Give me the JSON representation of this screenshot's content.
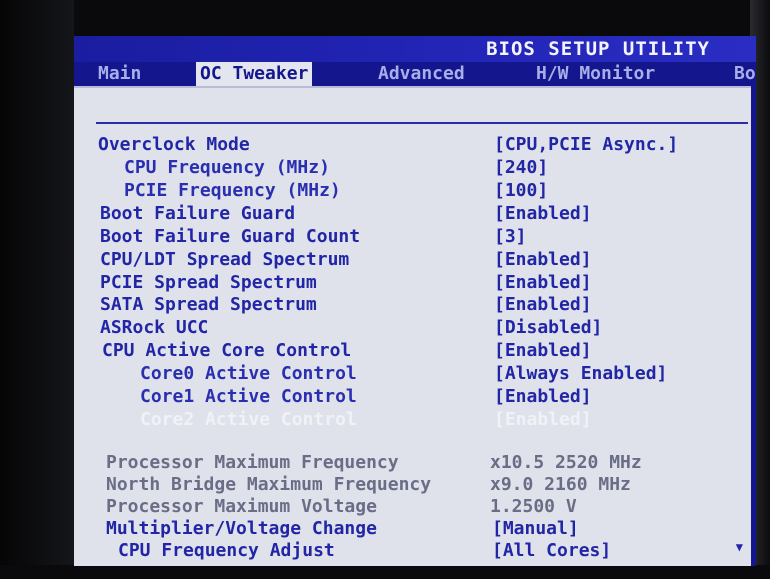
{
  "header": {
    "title": "BIOS SETUP UTILITY"
  },
  "tabs": [
    {
      "label": "Main"
    },
    {
      "label": "OC Tweaker"
    },
    {
      "label": "Advanced"
    },
    {
      "label": "H/W Monitor"
    },
    {
      "label": "Bo"
    }
  ],
  "settings": [
    {
      "label": "Overclock Mode",
      "value": "[CPU,PCIE Async.]"
    },
    {
      "label": "CPU Frequency (MHz)",
      "value": "[240]"
    },
    {
      "label": "PCIE Frequency (MHz)",
      "value": "[100]"
    },
    {
      "label": "Boot Failure Guard",
      "value": "[Enabled]"
    },
    {
      "label": "Boot Failure Guard Count",
      "value": "[3]"
    },
    {
      "label": "CPU/LDT Spread Spectrum",
      "value": "[Enabled]"
    },
    {
      "label": "PCIE Spread Spectrum",
      "value": "[Enabled]"
    },
    {
      "label": "SATA Spread Spectrum",
      "value": "[Enabled]"
    },
    {
      "label": "ASRock UCC",
      "value": "[Disabled]"
    },
    {
      "label": "CPU Active Core Control",
      "value": "[Enabled]"
    },
    {
      "label": "Core0 Active Control",
      "value": "[Always Enabled]"
    },
    {
      "label": "Core1 Active Control",
      "value": "[Enabled]"
    },
    {
      "label": "Core2 Active Control",
      "value": "[Enabled]"
    }
  ],
  "info": [
    {
      "label": "Processor Maximum Frequency",
      "value": "x10.5 2520 MHz"
    },
    {
      "label": "North Bridge Maximum Frequency",
      "value": "x9.0  2160 MHz"
    },
    {
      "label": "Processor Maximum Voltage",
      "value": "1.2500 V"
    }
  ],
  "settings2": [
    {
      "label": "Multiplier/Voltage Change",
      "value": "[Manual]"
    },
    {
      "label": "CPU Frequency Adjust",
      "value": "[All Cores]"
    }
  ],
  "scroll": {
    "icon": "triangle-down-icon"
  },
  "colors": {
    "title_bar": "#13168c",
    "panel": "#dfe2ea",
    "text": "#2226a6"
  }
}
